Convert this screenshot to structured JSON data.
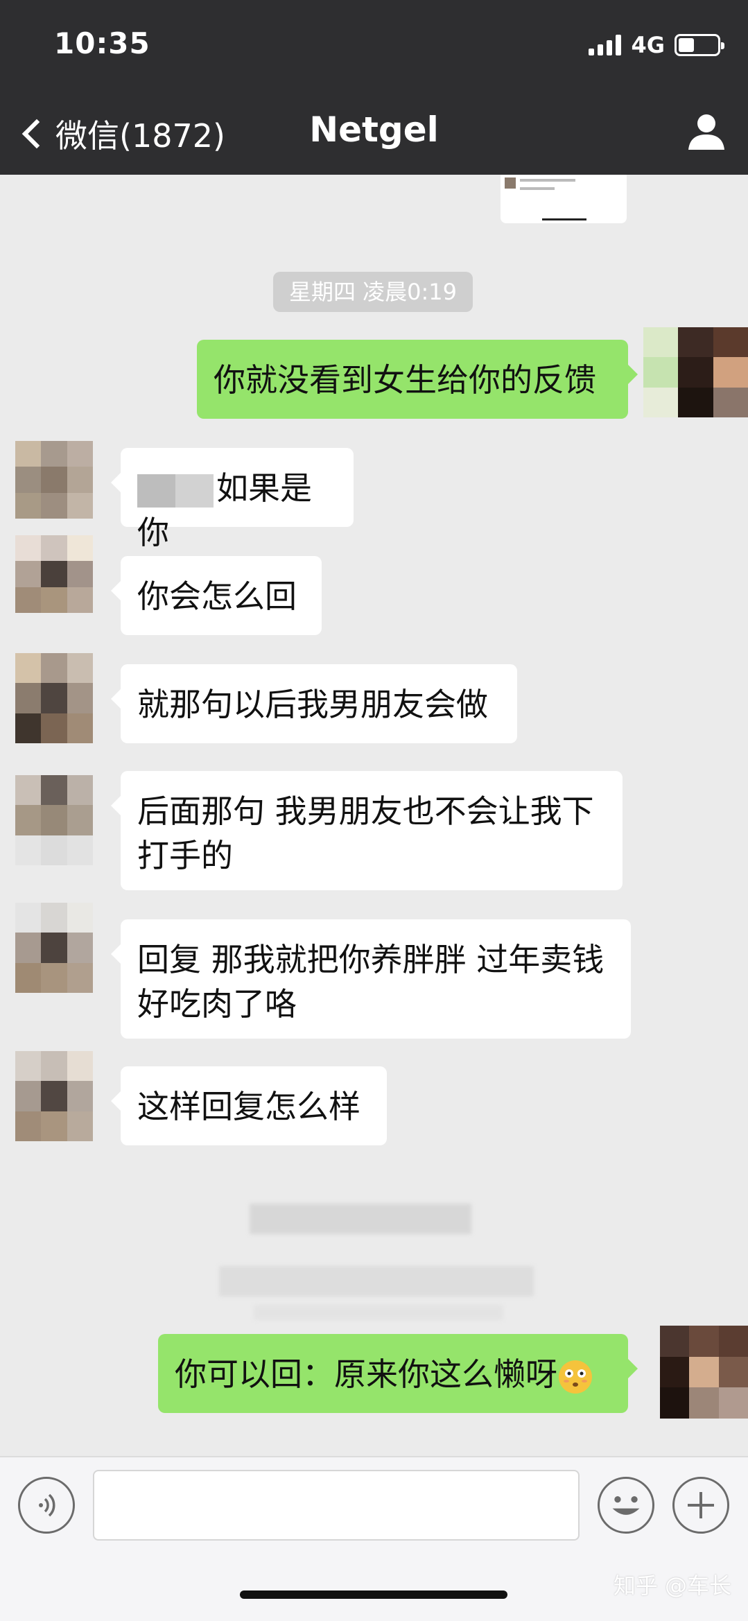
{
  "status_bar": {
    "time": "10:35",
    "network": "4G",
    "battery_level": 0.4
  },
  "nav": {
    "back_label": "微信(1872)",
    "title": "Netgel"
  },
  "chat": {
    "timestamp": "星期四 凌晨0:19",
    "messages": [
      {
        "side": "out",
        "text": "你就没看到女生给你的反馈"
      },
      {
        "side": "in",
        "text": "如果是你"
      },
      {
        "side": "in",
        "text": "你会怎么回"
      },
      {
        "side": "in",
        "text": "就那句以后我男朋友会做"
      },
      {
        "side": "in",
        "text_line1": "后面那句 我男朋友也不会让我下",
        "text_line2": "打手的"
      },
      {
        "side": "in",
        "text_line1": "回复 那我就把你养胖胖 过年卖钱",
        "text_line2": "好吃肉了咯"
      },
      {
        "side": "in",
        "text": "这样回复怎么样"
      },
      {
        "side": "out",
        "text": "你可以回：原来你这么懒呀",
        "emoji": "flushed-emoji"
      }
    ]
  },
  "input_bar": {
    "voice_icon": "voice-icon",
    "emoji_icon": "smiley-icon",
    "plus_icon": "plus-icon"
  },
  "watermark": "知乎 @车长",
  "colors": {
    "nav_bg": "#2e2e30",
    "chat_bg": "#ebebeb",
    "outgoing_bubble": "#95e46b",
    "incoming_bubble": "#ffffff"
  }
}
